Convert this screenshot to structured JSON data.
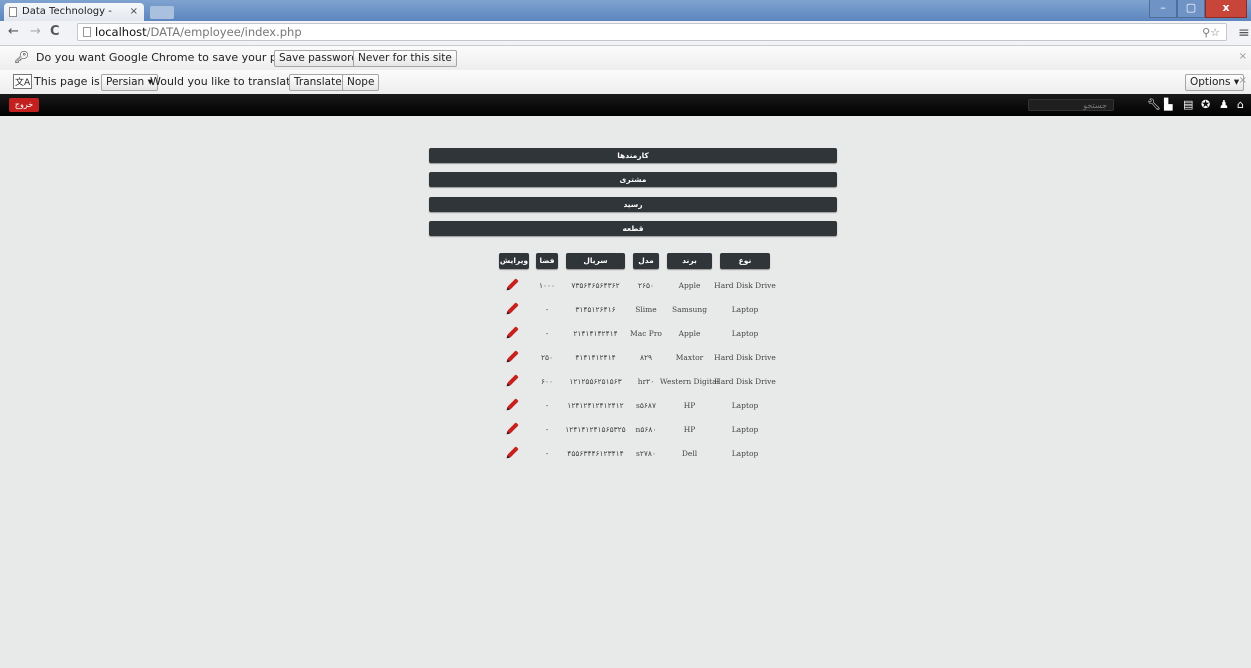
{
  "browser": {
    "tab_title": "Data Technology - Emplo",
    "url_host": "localhost",
    "url_path": "/DATA/employee/index.php",
    "window_controls": [
      "–",
      "▢",
      "x"
    ]
  },
  "password_bar": {
    "message": "Do you want Google Chrome to save your password?",
    "save_label": "Save password",
    "never_label": "Never for this site"
  },
  "translate_bar": {
    "prefix": "This page is in",
    "language": "Persian",
    "question": "Would you like to translate it?",
    "translate_label": "Translate",
    "nope_label": "Nope",
    "options_label": "Options"
  },
  "appbar": {
    "logout_label": "خروج",
    "search_placeholder": "جستجو",
    "icons": [
      "wrench-icon",
      "chart-icon",
      "document-icon",
      "settings-icon",
      "user-icon",
      "home-icon"
    ]
  },
  "menu": [
    "کارمندها",
    "مشتری",
    "رسید",
    "قطعه"
  ],
  "table": {
    "headers": {
      "type": "نوع",
      "brand": "برند",
      "model": "مدل",
      "serial": "سریال",
      "space": "فضا",
      "edit": "ویرایش"
    },
    "rows": [
      {
        "type": "Hard Disk Drive",
        "brand": "Apple",
        "model": "۲۶۵۰",
        "serial": "۷۳۵۶۴۶۵۶۴۳۶۲",
        "space": "۱۰۰۰"
      },
      {
        "type": "Laptop",
        "brand": "Samsung",
        "model": "Slime",
        "serial": "۳۱۴۵۱۲۶۴۱۶",
        "space": "-"
      },
      {
        "type": "Laptop",
        "brand": "Apple",
        "model": "Mac Pro",
        "serial": "۲۱۴۱۴۱۴۲۴۱۴",
        "space": "-"
      },
      {
        "type": "Hard Disk Drive",
        "brand": "Maxtor",
        "model": "۸۲۹",
        "serial": "۴۱۴۱۴۱۲۴۱۴",
        "space": "۲۵۰"
      },
      {
        "type": "Hard Disk Drive",
        "brand": "Western Digital",
        "model": "hr۲۰",
        "serial": "۱۲۱۲۵۵۶۲۵۱۵۶۳",
        "space": "۶۰۰"
      },
      {
        "type": "Laptop",
        "brand": "HP",
        "model": "s۵۶۸۷",
        "serial": "۱۲۴۱۲۴۱۲۴۱۲۴۱۲",
        "space": "-"
      },
      {
        "type": "Laptop",
        "brand": "HP",
        "model": "n۵۶۸۰",
        "serial": "۱۲۴۱۴۱۲۴۱۵۶۵۳۲۵",
        "space": "-"
      },
      {
        "type": "Laptop",
        "brand": "Dell",
        "model": "s۲۷۸۰",
        "serial": "۴۵۵۶۳۴۴۶۱۲۳۴۱۴",
        "space": "-"
      }
    ]
  }
}
